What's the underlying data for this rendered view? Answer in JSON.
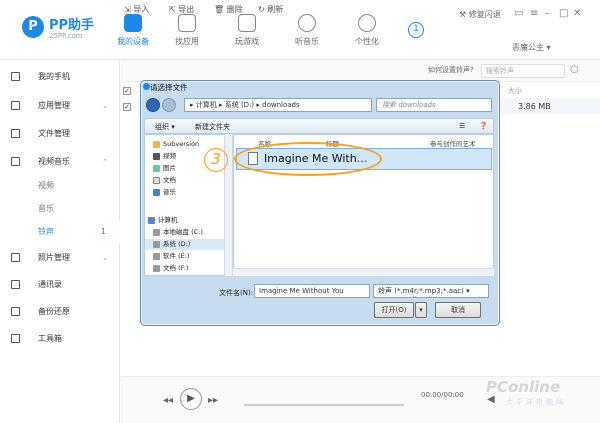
{
  "app": {
    "name": "PP助手",
    "site": "25PP.com"
  },
  "nav": [
    {
      "label": "我的设备",
      "active": true
    },
    {
      "label": "找应用"
    },
    {
      "label": "玩游戏"
    },
    {
      "label": "听音乐"
    },
    {
      "label": "个性化"
    }
  ],
  "notification_count": "1",
  "top_right": {
    "repair": "修复闪退",
    "user": "恶魔公主"
  },
  "sidebar": {
    "items": [
      {
        "label": "我的手机"
      },
      {
        "label": "应用管理"
      },
      {
        "label": "文件管理"
      },
      {
        "label": "视频音乐"
      },
      {
        "label": "视频"
      },
      {
        "label": "音乐"
      },
      {
        "label": "铃声",
        "count": "1"
      },
      {
        "label": "照片管理"
      },
      {
        "label": "通讯录"
      },
      {
        "label": "备份还原"
      },
      {
        "label": "工具箱"
      }
    ]
  },
  "toolbar": {
    "import": "导入",
    "export": "导出",
    "delete": "删除",
    "refresh": "刷新",
    "hint": "如何设置铃声?",
    "search_placeholder": "搜索铃声"
  },
  "table": {
    "col_size": "大小",
    "row_size": "3.86 MB"
  },
  "dialog": {
    "title": "请选择文件",
    "breadcrumb": [
      "计算机",
      "系统 (D:)",
      "downloads"
    ],
    "search_placeholder": "搜索 downloads",
    "organize": "组织 ▾",
    "new_folder": "新建文件夹",
    "tree": [
      "Subversion",
      "视频",
      "图片",
      "文档",
      "音乐",
      "计算机",
      "本地磁盘 (C:)",
      "系统 (D:)",
      "软件 (E:)",
      "文档 (F:)"
    ],
    "col_name": "名称",
    "col_title": "标题",
    "col_artist": "参与创作的艺术",
    "file_name": "Imagine Me With...",
    "step": "3",
    "filename_label": "文件名(N):",
    "filename_value": "Imagine Me Without You",
    "filetype": "铃声 (*.m4r;*.mp3;*.aac)",
    "open": "打开(O)",
    "cancel": "取消"
  },
  "player": {
    "time": "00:00/00:00"
  },
  "watermark": {
    "brand": "PConline",
    "sub": "太平洋电脑网"
  }
}
